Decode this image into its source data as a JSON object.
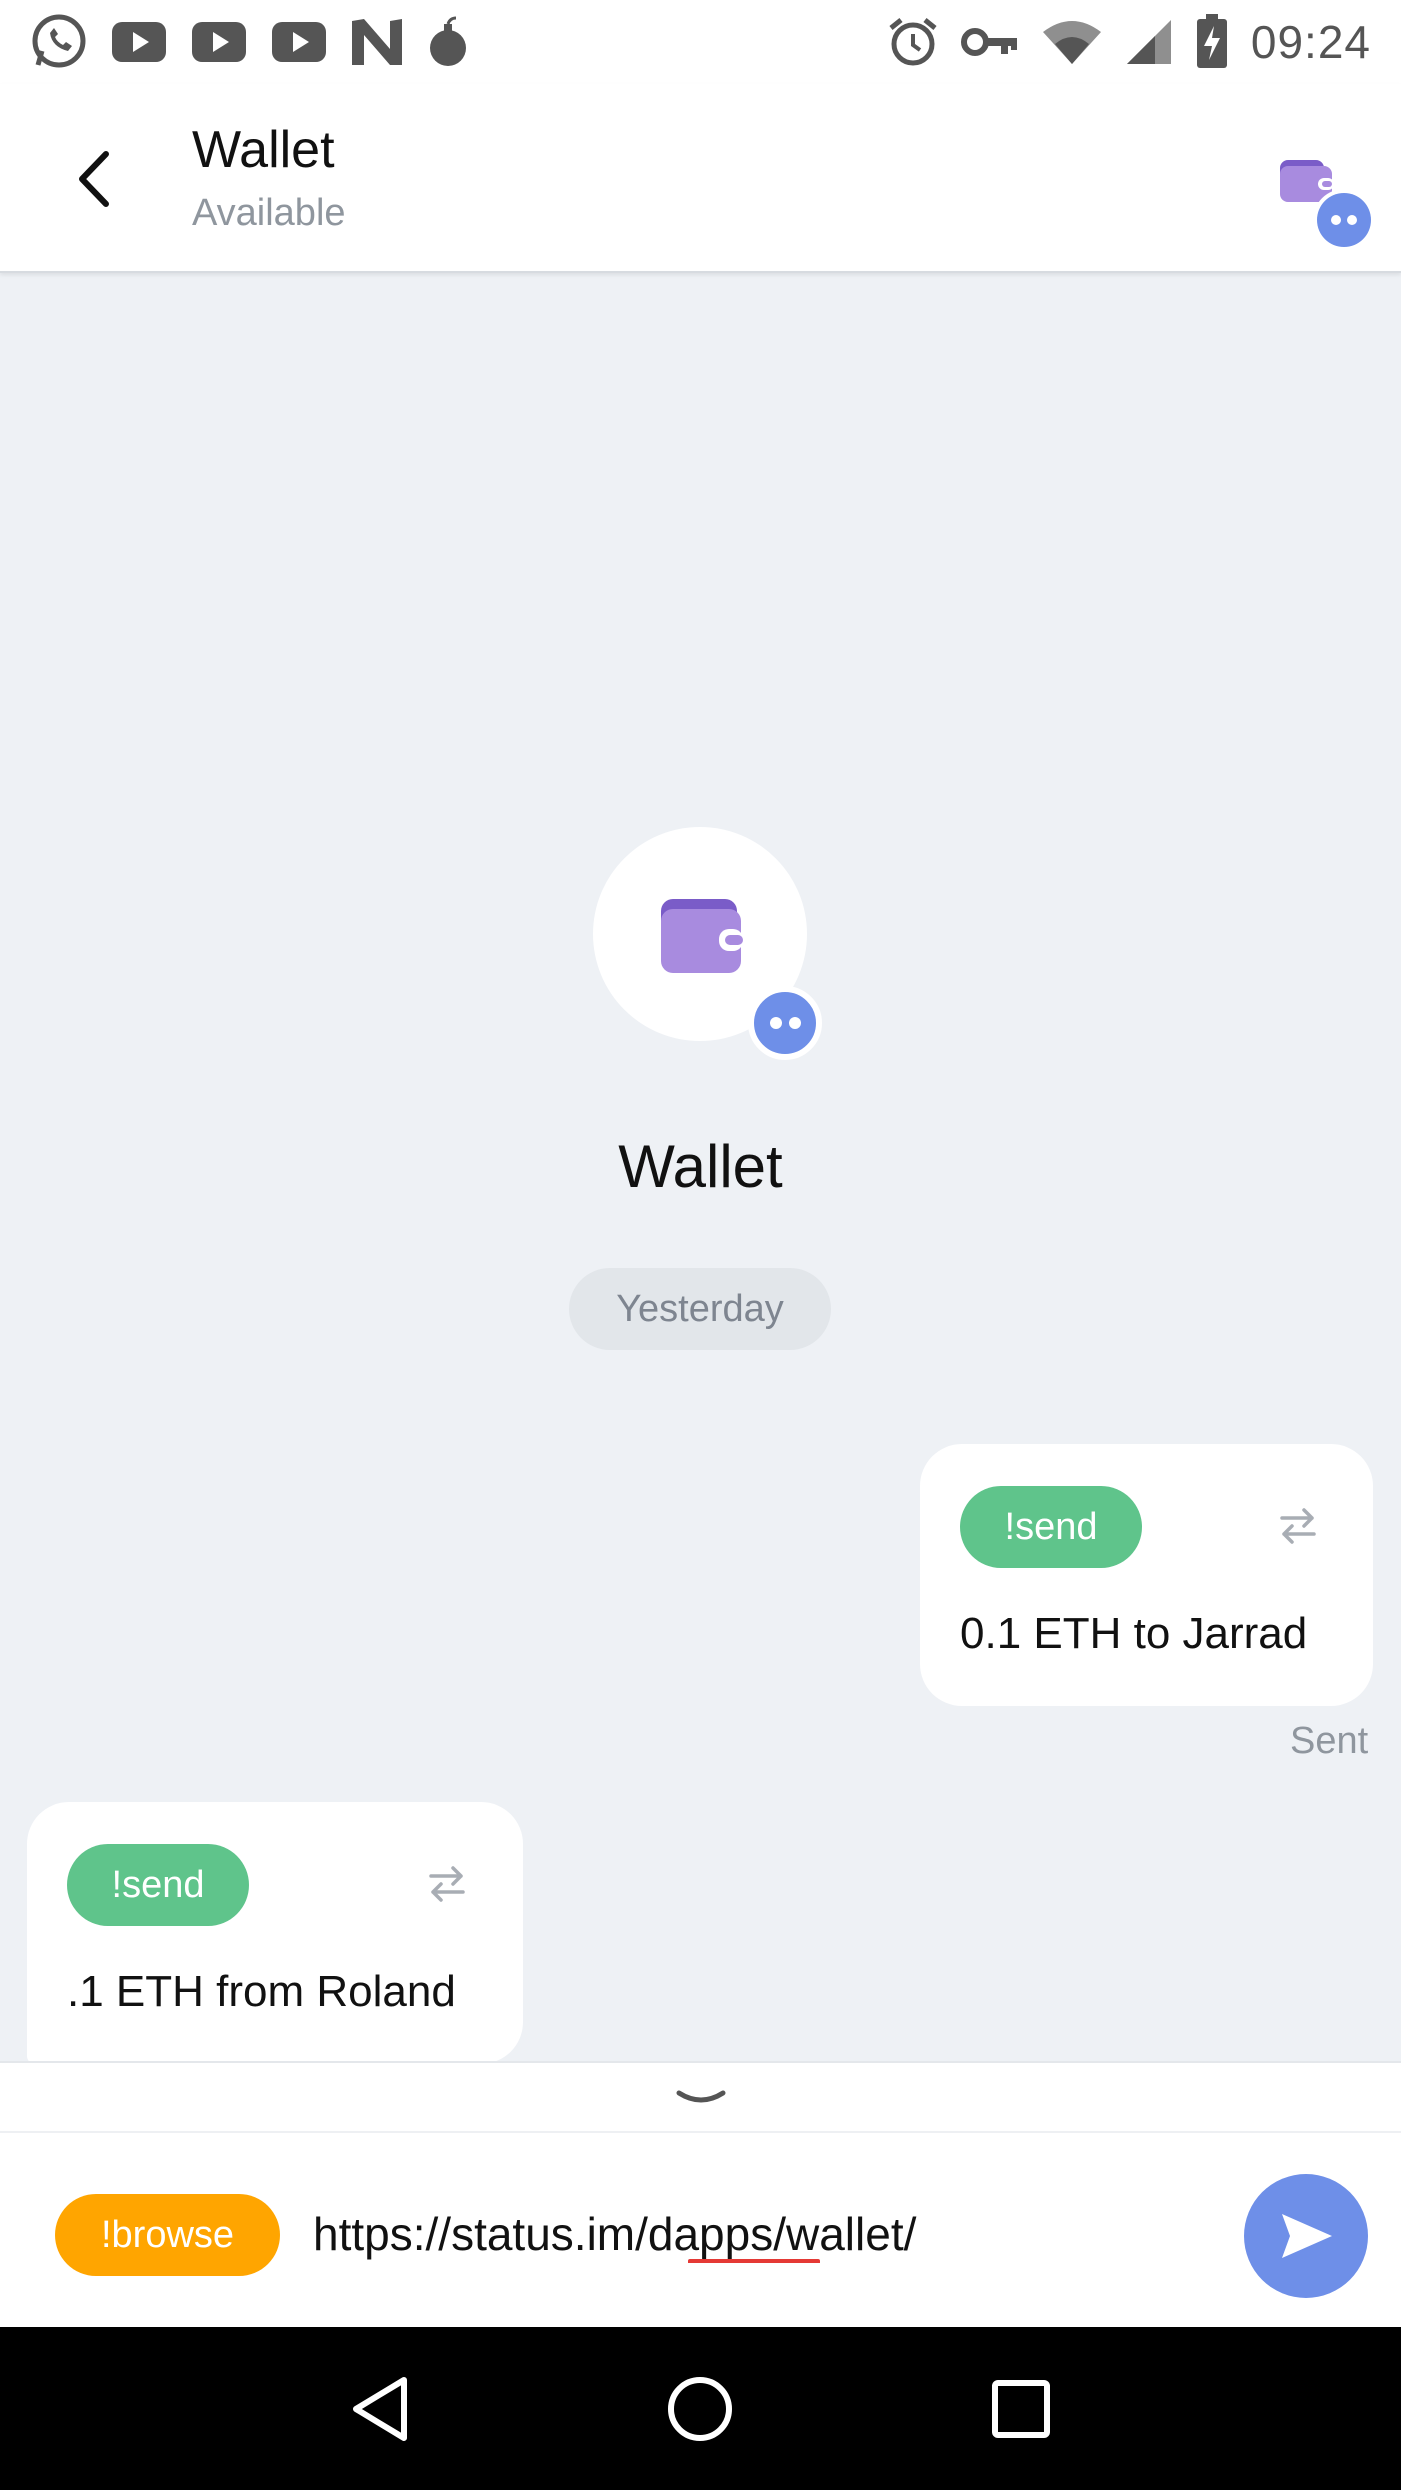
{
  "status_bar": {
    "time": "09:24",
    "left_icons": [
      "whatsapp-icon",
      "youtube-icon",
      "youtube-icon",
      "youtube-icon",
      "n-icon",
      "bomb-icon"
    ],
    "right_icons": [
      "alarm-icon",
      "key-icon",
      "wifi-icon",
      "signal-icon",
      "battery-charging-icon"
    ]
  },
  "toolbar": {
    "title": "Wallet",
    "subtitle": "Available"
  },
  "profile": {
    "name": "Wallet"
  },
  "date_divider": "Yesterday",
  "messages": [
    {
      "direction": "outgoing",
      "command": "!send",
      "text": "0.1 ETH to Jarrad",
      "status": "Sent"
    },
    {
      "direction": "incoming",
      "command": "!send",
      "text": ".1 ETH from Roland"
    }
  ],
  "input": {
    "command": "!browse",
    "value": "https://status.im/dapps/wallet/"
  },
  "colors": {
    "accent_blue": "#6e8fe8",
    "command_green": "#5fc48b",
    "browse_orange": "#ffa500",
    "wallet_purple": "#a88bdf"
  }
}
